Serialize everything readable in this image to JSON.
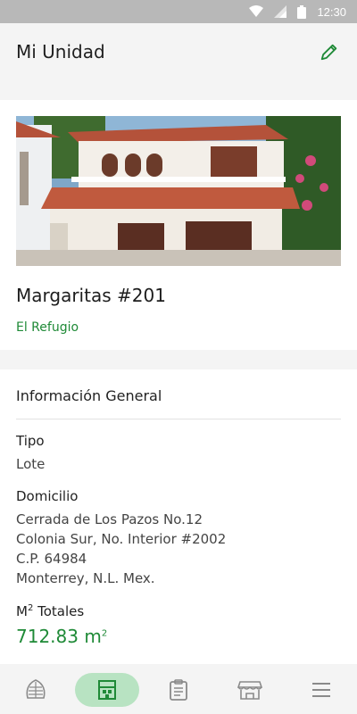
{
  "status_bar": {
    "time": "12:30"
  },
  "app_bar": {
    "title": "Mi Unidad",
    "edit_icon": "pencil-icon"
  },
  "unit": {
    "name": "Margaritas #201",
    "complex": "El Refugio"
  },
  "general_info": {
    "title": "Información General",
    "type_label": "Tipo",
    "type_value": "Lote",
    "address_label": "Domicilio",
    "address_lines": [
      "Cerrada de Los Pazos No.12",
      "Colonia Sur, No. Interior #2002",
      "C.P. 64984",
      "Monterrey, N.L. Mex."
    ],
    "area_label": "M",
    "area_label_sup": "2",
    "area_label_rest": " Totales",
    "area_value": "712.83 m",
    "area_value_sup": "2"
  },
  "bottom_nav": {
    "items": [
      {
        "icon": "leaf-shell-icon",
        "active": false
      },
      {
        "icon": "building-icon",
        "active": true
      },
      {
        "icon": "clipboard-icon",
        "active": false
      },
      {
        "icon": "store-awning-icon",
        "active": false
      },
      {
        "icon": "menu-icon",
        "active": false
      }
    ]
  },
  "colors": {
    "accent": "#1f8a37",
    "active_pill": "#b8e3c2",
    "status_bar": "#b8b8b8"
  }
}
